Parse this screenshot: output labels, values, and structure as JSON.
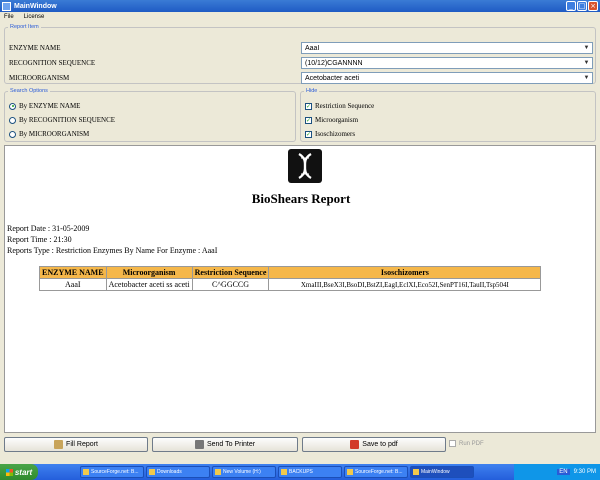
{
  "window": {
    "title": "MainWindow"
  },
  "menu": {
    "items": [
      "File",
      "License"
    ]
  },
  "report_item": {
    "legend": "Report Item",
    "rows": [
      {
        "label": "ENZYME NAME",
        "value": "AaaI"
      },
      {
        "label": "RECOGNITION SEQUENCE",
        "value": "(10/12)CGANNNN"
      },
      {
        "label": "MICROORGANISM",
        "value": "Acetobacter aceti"
      }
    ]
  },
  "search_options": {
    "legend": "Search Options",
    "options": [
      {
        "label": "By ENZYME NAME",
        "selected": true
      },
      {
        "label": "By RECOGNITION SEQUENCE",
        "selected": false
      },
      {
        "label": "By MICROORGANISM",
        "selected": false
      }
    ]
  },
  "hide": {
    "legend": "Hide",
    "options": [
      {
        "label": "Restriction Sequence",
        "checked": true
      },
      {
        "label": "Microorganism",
        "checked": true
      },
      {
        "label": "Isoschizomers",
        "checked": true
      }
    ]
  },
  "report": {
    "title": "BioShears Report",
    "date": "Report Date : 31-05-2009",
    "time": "Report Time : 21:30",
    "type": "Reports Type : Restriction Enzymes By Name For Enzyme : AaaI",
    "headers": [
      "ENZYME NAME",
      "Microorganism",
      "Restriction Sequence",
      "Isoschizomers"
    ],
    "rows": [
      [
        "AaaI",
        "Acetobacter aceti ss aceti",
        "C^GGCCG",
        "XmaIII,BseX3I,BsoDI,BstZI,EagI,EclXI,Eco52I,SenPT16I,TauII,Tsp504I"
      ]
    ]
  },
  "buttons": {
    "fill_report": "Fill Report",
    "send_to_printer": "Send To Printer",
    "save_to_pdf": "Save to pdf",
    "run_pdf": "Run PDF"
  },
  "taskbar": {
    "start": "start",
    "tasks": [
      "SourceForge.net: B...",
      "Downloads",
      "New Volume (H:)",
      "BACKUPS",
      "SourceForge.net: B...",
      "MainWindow"
    ],
    "lang": "EN",
    "clock": "9:30 PM"
  },
  "colors": {
    "accent": "#2a5bd7",
    "table_header": "#f5b74a"
  }
}
